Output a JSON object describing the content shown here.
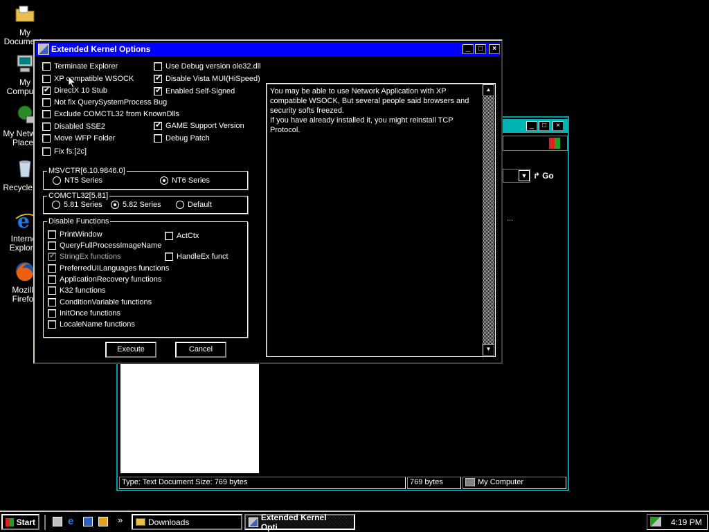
{
  "desktop": {
    "icons": [
      {
        "label": "My\nDocuments"
      },
      {
        "label": "My\nComputer"
      },
      {
        "label": "My Network\nPlaces"
      },
      {
        "label": "Recycle Bin"
      },
      {
        "label": "Internet\nExplorer"
      },
      {
        "label": "Mozilla\nFirefox"
      }
    ]
  },
  "bg_window": {
    "go_label": "Go",
    "status_text": "Type: Text Document Size: 769 bytes",
    "status_size": "769 bytes",
    "status_location": "My Computer",
    "ellipsis": "..."
  },
  "dialog": {
    "title": "Extended Kernel Options",
    "left_checks": [
      {
        "label": "Terminate Explorer",
        "checked": false
      },
      {
        "label": "XP compatible WSOCK",
        "checked": false
      },
      {
        "label": "DirectX 10 Stub",
        "checked": true
      },
      {
        "label": "Not fix QuerySystemProcess Bug",
        "checked": false
      },
      {
        "label": "Exclude COMCTL32 from KnownDlls",
        "checked": false
      },
      {
        "label": "Disabled SSE2",
        "checked": false
      },
      {
        "label": "Move WFP Folder",
        "checked": false
      },
      {
        "label": "Fix fs:[2c]",
        "checked": false
      }
    ],
    "right_checks": [
      {
        "label": "Use Debug version ole32.dll",
        "checked": false
      },
      {
        "label": "Disable Vista MUI(HiSpeed)",
        "checked": true
      },
      {
        "label": "Enabled Self-Signed",
        "checked": true
      },
      {
        "label": "GAME Support Version",
        "checked": true
      },
      {
        "label": "Debug Patch",
        "checked": false
      }
    ],
    "msvctr": {
      "legend": "MSVCTR[6.10.9846.0]",
      "options": [
        "NT5 Series",
        "NT6 Series"
      ],
      "selected": 1
    },
    "comctl": {
      "legend": "COMCTL32[5.81]",
      "options": [
        "5.81 Series",
        "5.82 Series",
        "Default"
      ],
      "selected": 1
    },
    "disable_functions": {
      "legend": "Disable Functions",
      "left": [
        {
          "label": "PrintWindow",
          "checked": false,
          "disabled": false
        },
        {
          "label": "QueryFullProcessImageName",
          "checked": false,
          "disabled": false
        },
        {
          "label": "StringEx functions",
          "checked": true,
          "disabled": true
        },
        {
          "label": "PreferredUILanguages functions",
          "checked": false,
          "disabled": false
        },
        {
          "label": "ApplicationRecovery functions",
          "checked": false,
          "disabled": false
        },
        {
          "label": "K32 functions",
          "checked": false,
          "disabled": false
        },
        {
          "label": "ConditionVariable functions",
          "checked": false,
          "disabled": false
        },
        {
          "label": "InitOnce functions",
          "checked": false,
          "disabled": false
        },
        {
          "label": "LocaleName functions",
          "checked": false,
          "disabled": false
        }
      ],
      "right": [
        {
          "label": "ActCtx",
          "checked": false,
          "disabled": false
        },
        {
          "label": "HandleEx funct",
          "checked": false,
          "disabled": false
        }
      ]
    },
    "execute_label": "Execute",
    "cancel_label": "Cancel",
    "info_text": "You may be able to use Network Application with XP compatible WSOCK, But several people said browsers and security softs freezed.\nIf you have already installed it, you might reinstall TCP Protocol."
  },
  "taskbar": {
    "start_label": "Start",
    "tasks": [
      "Downloads",
      "Extended Kernel Opti..."
    ],
    "active_task": 1,
    "clock": "4:19 PM",
    "quicklaunch_more": "»"
  },
  "colors": {
    "titlebar_active": "#0000ff",
    "titlebar_inactive": "#00b4b4",
    "background": "#000000"
  }
}
